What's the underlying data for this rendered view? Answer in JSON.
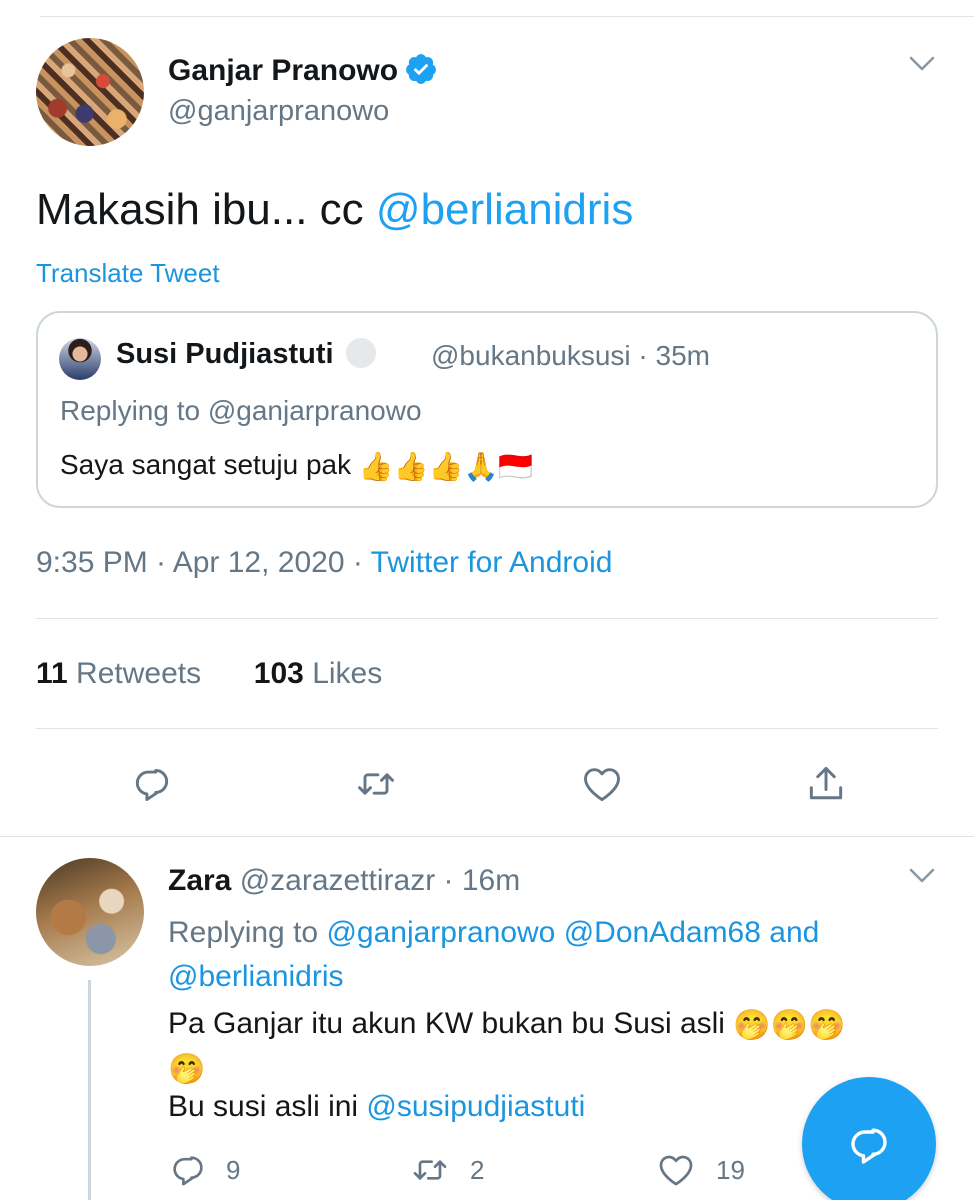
{
  "tweet": {
    "author": {
      "name": "Ganjar Pranowo",
      "handle": "@ganjarpranowo",
      "verified": true
    },
    "text": "Makasih ibu... cc ",
    "mention": "@berlianidris",
    "translate_label": "Translate Tweet",
    "quoted": {
      "name": "Susi Pudjiastuti",
      "handle_time": "@bukanbuksusi · 35m",
      "replying_to": "Replying to @ganjarpranowo",
      "text": "Saya sangat setuju pak ",
      "emoji": "👍👍👍🙏🇮🇩"
    },
    "time": "9:35 PM · Apr 12, 2020 · ",
    "source": "Twitter for Android",
    "retweets_count": "11",
    "retweets_label": " Retweets",
    "likes_count": "103",
    "likes_label": " Likes"
  },
  "reply": {
    "name": "Zara",
    "handle_time": " @zarazettirazr · 16m",
    "replying_prefix": "Replying to ",
    "replying_mentions": "@ganjarpranowo @DonAdam68",
    "replying_and": " and",
    "replying_last": "@berlianidris",
    "text": "Pa Ganjar itu akun KW bukan bu Susi asli ",
    "text_emoji": "🤭🤭🤭",
    "text_emoji_wrap": "🤭",
    "text2_prefix": "Bu susi asli ini ",
    "text2_mention": "@susipudjiastuti",
    "replies_count": "9",
    "retweets_count": "2",
    "likes_count": "19"
  },
  "icons": {
    "verified": "verified-badge-icon",
    "more": "chevron-down-icon",
    "reply": "reply-icon",
    "retweet": "retweet-icon",
    "like": "heart-icon",
    "share": "share-icon",
    "compose": "compose-reply-icon"
  },
  "colors": {
    "accent": "#1da1f2",
    "link": "#1b95e0",
    "secondary_text": "#657786",
    "border": "#ccd6dd"
  }
}
